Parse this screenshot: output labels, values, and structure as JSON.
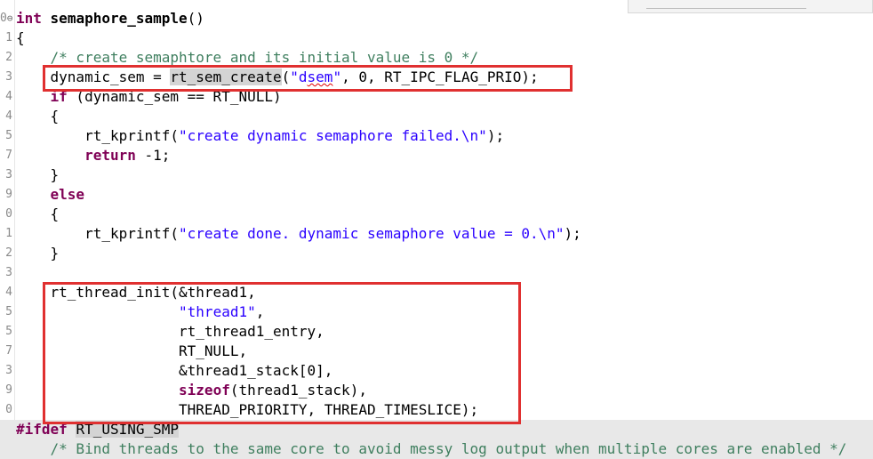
{
  "editor": {
    "lines": [
      {
        "num": "0",
        "fold": "⊖",
        "parts": [
          {
            "t": "int",
            "c": "kw"
          },
          {
            "t": " "
          },
          {
            "t": "semaphore_sample",
            "c": "fnbold"
          },
          {
            "t": "()"
          }
        ]
      },
      {
        "num": "1",
        "parts": [
          {
            "t": "{"
          }
        ]
      },
      {
        "num": "2",
        "parts": [
          {
            "t": "    "
          },
          {
            "t": "/* create semaphtore and its initial value is 0 */",
            "c": "cmt"
          }
        ]
      },
      {
        "num": "3",
        "parts": [
          {
            "t": "    dynamic_sem = "
          },
          {
            "t": "rt_sem_create",
            "c": "hl"
          },
          {
            "t": "("
          },
          {
            "t": "\"d",
            "c": "str"
          },
          {
            "t": "sem",
            "c": "str squig"
          },
          {
            "t": "\"",
            "c": "str"
          },
          {
            "t": ", 0, RT_IPC_FLAG_PRIO);"
          }
        ]
      },
      {
        "num": "4",
        "parts": [
          {
            "t": "    "
          },
          {
            "t": "if",
            "c": "kw"
          },
          {
            "t": " (dynamic_sem == RT_NULL)"
          }
        ]
      },
      {
        "num": "4",
        "parts": [
          {
            "t": "    {"
          }
        ]
      },
      {
        "num": "5",
        "parts": [
          {
            "t": "        rt_kprintf("
          },
          {
            "t": "\"create dynamic semaphore failed.\\n\"",
            "c": "str"
          },
          {
            "t": ");"
          }
        ]
      },
      {
        "num": "7",
        "parts": [
          {
            "t": "        "
          },
          {
            "t": "return",
            "c": "kw"
          },
          {
            "t": " -1;"
          }
        ]
      },
      {
        "num": "3",
        "parts": [
          {
            "t": "    }"
          }
        ]
      },
      {
        "num": "9",
        "parts": [
          {
            "t": "    "
          },
          {
            "t": "else",
            "c": "kw"
          }
        ]
      },
      {
        "num": "0",
        "parts": [
          {
            "t": "    {"
          }
        ]
      },
      {
        "num": "1",
        "parts": [
          {
            "t": "        rt_kprintf("
          },
          {
            "t": "\"create done. dynamic semaphore value = 0.\\n\"",
            "c": "str"
          },
          {
            "t": ");"
          }
        ]
      },
      {
        "num": "2",
        "parts": [
          {
            "t": "    }"
          }
        ]
      },
      {
        "num": "3",
        "parts": []
      },
      {
        "num": "4",
        "parts": [
          {
            "t": "    rt_thread_init(&thread1,"
          }
        ]
      },
      {
        "num": "5",
        "parts": [
          {
            "t": "                   "
          },
          {
            "t": "\"thread1\"",
            "c": "str"
          },
          {
            "t": ","
          }
        ]
      },
      {
        "num": "5",
        "parts": [
          {
            "t": "                   rt_thread1_entry,"
          }
        ]
      },
      {
        "num": "7",
        "parts": [
          {
            "t": "                   RT_NULL,"
          }
        ]
      },
      {
        "num": "3",
        "parts": [
          {
            "t": "                   &thread1_stack[0],"
          }
        ]
      },
      {
        "num": "9",
        "parts": [
          {
            "t": "                   "
          },
          {
            "t": "sizeof",
            "c": "kw"
          },
          {
            "t": "(thread1_stack),"
          }
        ]
      },
      {
        "num": "0",
        "parts": [
          {
            "t": "                   THREAD_PRIORITY, THREAD_TIMESLICE);"
          }
        ]
      },
      {
        "num": "",
        "bg": "gray",
        "parts": [
          {
            "t": "#ifdef",
            "c": "kw"
          },
          {
            "t": " "
          },
          {
            "t": "RT_USING_SMP",
            "c": "hl"
          }
        ]
      },
      {
        "num": "",
        "bg": "gray",
        "parts": [
          {
            "t": "    "
          },
          {
            "t": "/* Bind threads to the same core to avoid messy log output when multiple cores are enabled */",
            "c": "cmt"
          }
        ]
      }
    ]
  },
  "colors": {
    "keyword": "#7f0055",
    "string": "#2a00ff",
    "comment": "#3f7f5f",
    "highlight_box": "#e03030"
  }
}
